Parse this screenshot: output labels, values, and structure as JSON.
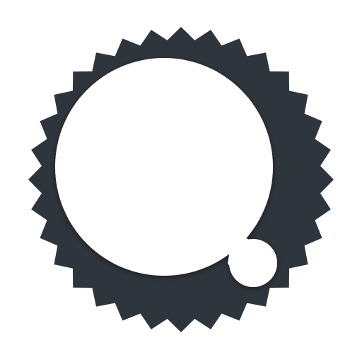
{
  "logo": {
    "name": "serrated-badge-with-circle-logo",
    "colors": {
      "background": "#ffffff",
      "badge": "#2f353c",
      "cutout": "#ffffff",
      "shadow": "#000000"
    }
  }
}
